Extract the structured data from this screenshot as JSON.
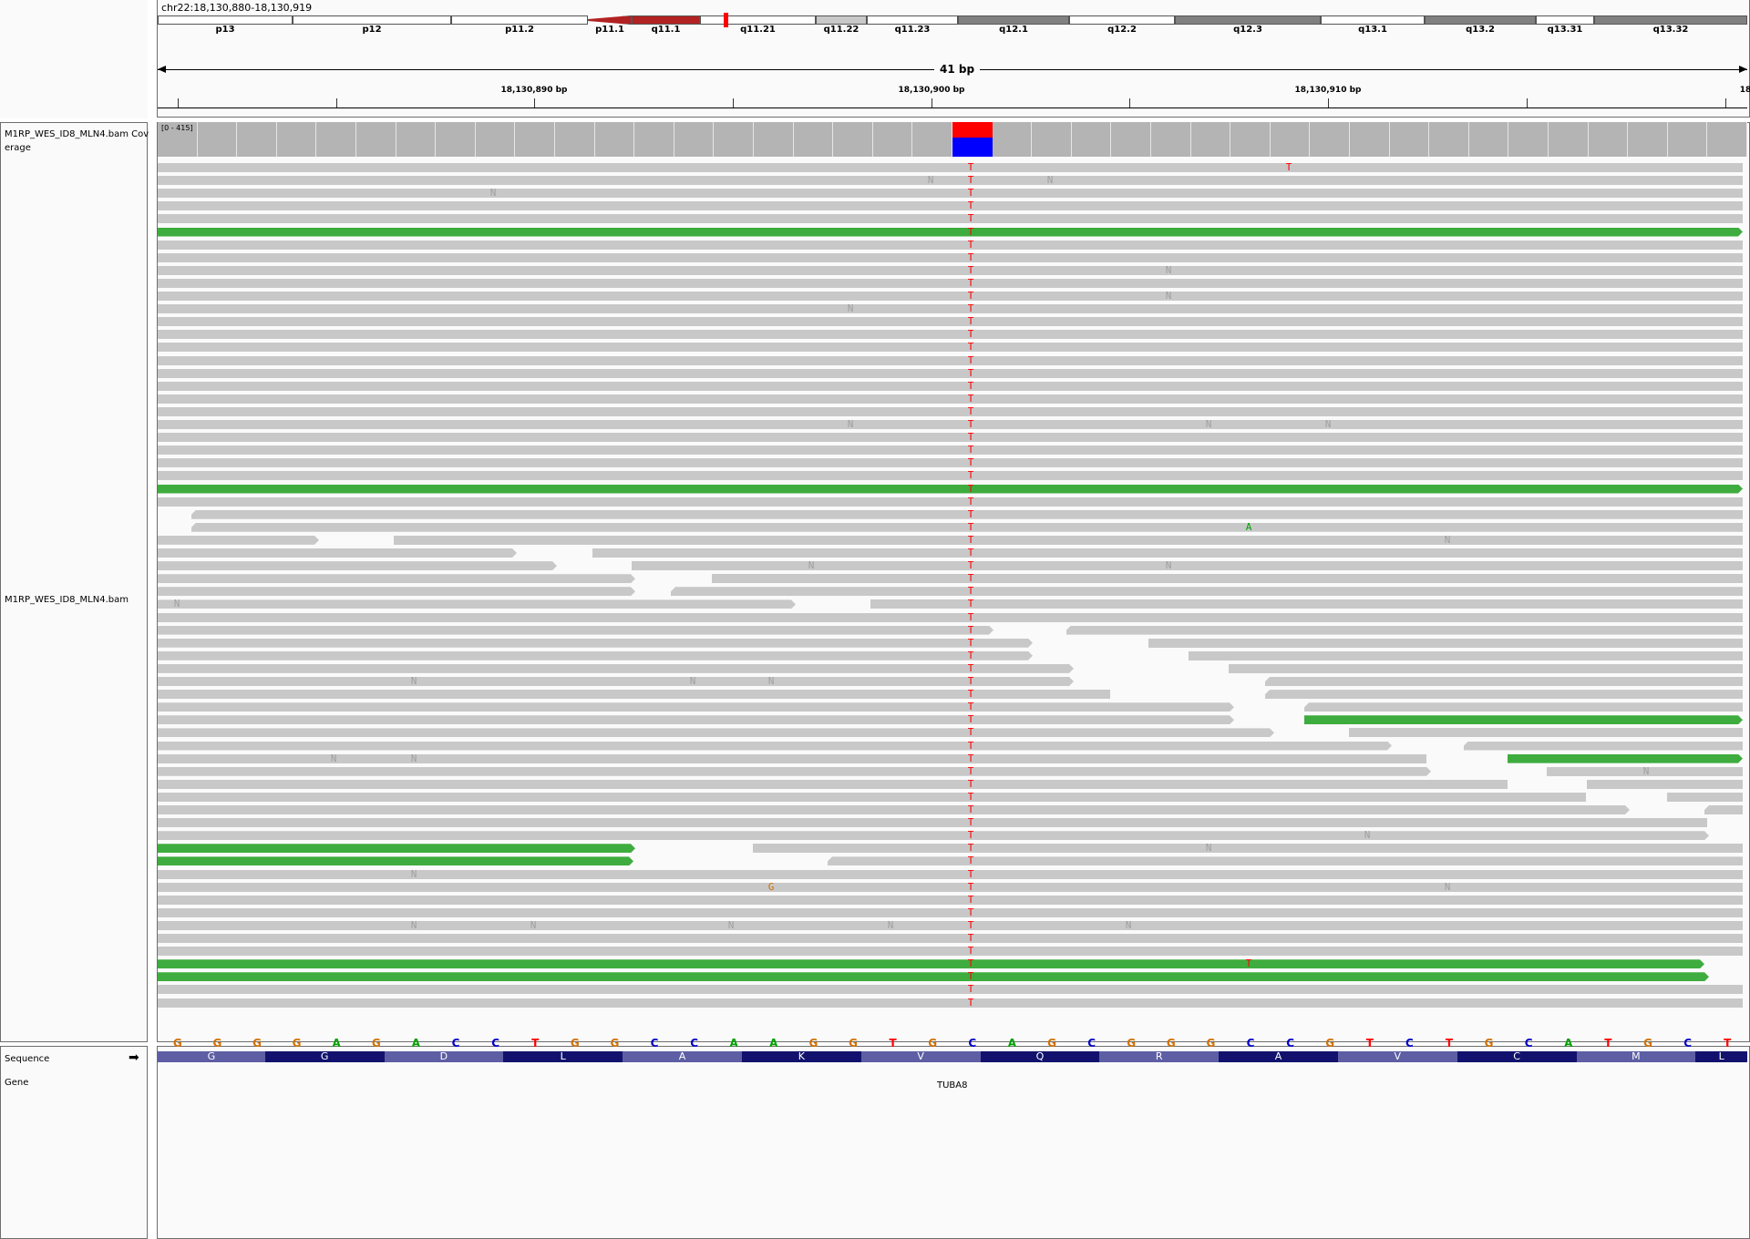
{
  "locus": "chr22:18,130,880-18,130,919",
  "ideogram": {
    "bands": [
      {
        "name": "p13",
        "color": "#ffffff"
      },
      {
        "name": "p12",
        "color": "#ffffff"
      },
      {
        "name": "p11.2",
        "color": "#ffffff"
      },
      {
        "name": "p11.1",
        "color": "#b22222"
      },
      {
        "name": "q11.1",
        "color": "#b22222"
      },
      {
        "name": "q11.21",
        "color": "#ffffff"
      },
      {
        "name": "q11.22",
        "color": "#c8c8c8"
      },
      {
        "name": "q11.23",
        "color": "#ffffff"
      },
      {
        "name": "q12.1",
        "color": "#808080"
      },
      {
        "name": "q12.2",
        "color": "#ffffff"
      },
      {
        "name": "q12.3",
        "color": "#808080"
      },
      {
        "name": "q13.1",
        "color": "#ffffff"
      },
      {
        "name": "q13.2",
        "color": "#808080"
      },
      {
        "name": "q13.31",
        "color": "#ffffff"
      },
      {
        "name": "q13.32",
        "color": "#808080"
      }
    ],
    "current_position_color": "#ff0000"
  },
  "ruler": {
    "span": "41 bp",
    "labels": [
      "18,130,890 bp",
      "18,130,900 bp",
      "18,130,910 bp",
      "18"
    ]
  },
  "tracks": {
    "coverage_name": "M1RP_WES_ID8_MLN4.bam Coverage",
    "coverage_range": "[0 - 415]",
    "alignment_name": "M1RP_WES_ID8_MLN4.bam",
    "sequence_name": "Sequence",
    "gene_name": "Gene"
  },
  "colors": {
    "read": "#c8c8c8",
    "read_highlight": "#3eac3e",
    "base_A": "#00a000",
    "base_C": "#0000c8",
    "base_G": "#d17105",
    "base_T": "#ff0000",
    "base_N": "#a0a0a0",
    "coverage_ref_fraction": "#ff0000",
    "coverage_alt_fraction": "#0000ff"
  },
  "allele_fraction": {
    "T": 0.45,
    "C": 0.55
  },
  "sequence": [
    "G",
    "G",
    "G",
    "G",
    "A",
    "G",
    "A",
    "C",
    "C",
    "T",
    "G",
    "G",
    "C",
    "C",
    "A",
    "A",
    "G",
    "G",
    "T",
    "G",
    "C",
    "A",
    "G",
    "C",
    "G",
    "G",
    "G",
    "C",
    "C",
    "G",
    "T",
    "C",
    "T",
    "G",
    "C",
    "A",
    "T",
    "G",
    "C",
    "T"
  ],
  "amino_acids": [
    "G",
    "G",
    "D",
    "L",
    "A",
    "K",
    "V",
    "Q",
    "R",
    "A",
    "V",
    "C",
    "M",
    "L"
  ],
  "gene": "TUBA8",
  "mismatch_labels": {
    "T": "T",
    "N": "N",
    "A": "A",
    "G": "G"
  }
}
